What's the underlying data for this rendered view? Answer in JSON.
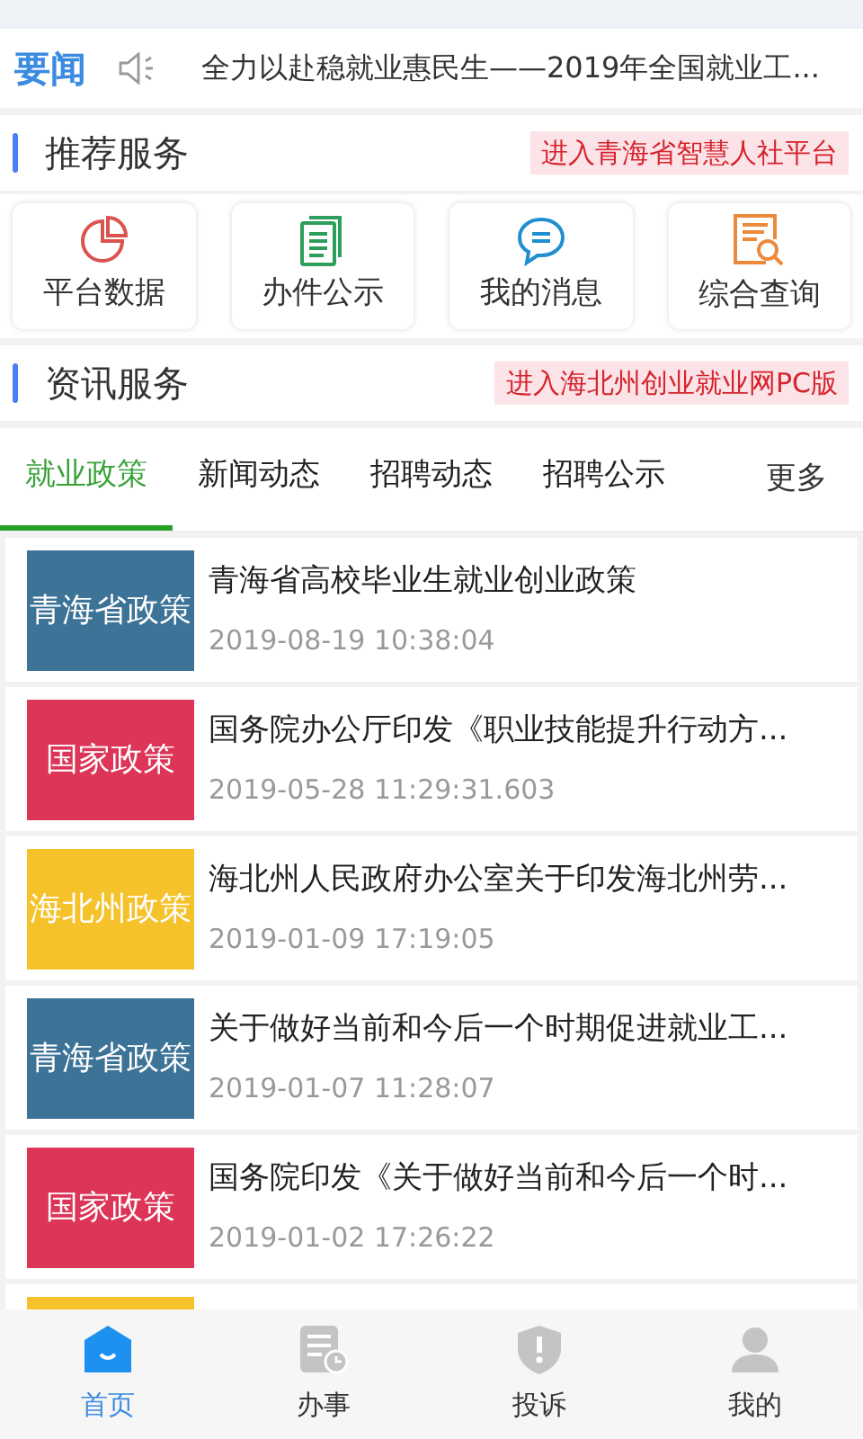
{
  "news_bar": {
    "label": "要闻",
    "headline": "全力以赴稳就业惠民生——2019年全国就业工..."
  },
  "sections": [
    {
      "title": "推荐服务",
      "link": "进入青海省智慧人社平台"
    },
    {
      "title": "资讯服务",
      "link": "进入海北州创业就业网PC版"
    }
  ],
  "services": [
    {
      "label": "平台数据",
      "kind": "chart"
    },
    {
      "label": "办件公示",
      "kind": "document"
    },
    {
      "label": "我的消息",
      "kind": "message"
    },
    {
      "label": "综合查询",
      "kind": "search"
    }
  ],
  "tabs": [
    {
      "label": "就业政策",
      "selected": true
    },
    {
      "label": "新闻动态",
      "selected": false
    },
    {
      "label": "招聘动态",
      "selected": false
    },
    {
      "label": "招聘公示",
      "selected": false
    }
  ],
  "more": "更多",
  "articles": [
    {
      "tag": "青海省政策",
      "color": "#3d7396",
      "title": "青海省高校毕业生就业创业政策",
      "time": "2019-08-19 10:38:04"
    },
    {
      "tag": "国家政策",
      "color": "#dc3558",
      "title": "国务院办公厅印发《职业技能提升行动方...",
      "time": "2019-05-28 11:29:31.603"
    },
    {
      "tag": "海北州政策",
      "color": "#f5c22b",
      "title": "海北州人民政府办公室关于印发海北州劳...",
      "time": "2019-01-09 17:19:05"
    },
    {
      "tag": "青海省政策",
      "color": "#3d7396",
      "title": "关于做好当前和今后一个时期促进就业工...",
      "time": "2019-01-07 11:28:07"
    },
    {
      "tag": "国家政策",
      "color": "#dc3558",
      "title": "国务院印发《关于做好当前和今后一个时...",
      "time": "2019-01-02 17:26:22"
    },
    {
      "color": "#f5c22b"
    }
  ],
  "bottom_nav": [
    {
      "label": "首页",
      "kind": "home",
      "selected": true
    },
    {
      "label": "办事",
      "kind": "tasks",
      "selected": false
    },
    {
      "label": "投诉",
      "kind": "complaint",
      "selected": false
    },
    {
      "label": "我的",
      "kind": "profile",
      "selected": false
    }
  ]
}
